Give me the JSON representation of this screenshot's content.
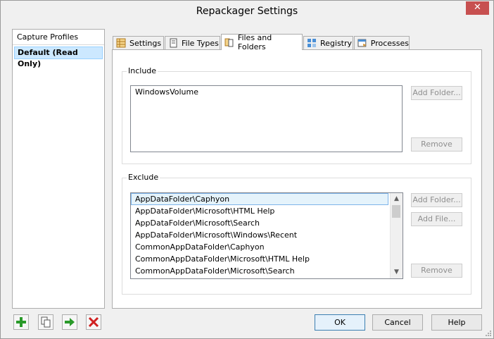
{
  "window": {
    "title": "Repackager Settings",
    "close_glyph": "✕"
  },
  "sidebar": {
    "header": "Capture Profiles",
    "items": [
      {
        "label": "Default (Read Only)"
      }
    ]
  },
  "tabs": [
    {
      "label": "Settings",
      "icon": "settings-grid-icon"
    },
    {
      "label": "File Types",
      "icon": "file-types-icon"
    },
    {
      "label": "Files and Folders",
      "icon": "files-folders-icon",
      "active": true
    },
    {
      "label": "Registry",
      "icon": "registry-icon"
    },
    {
      "label": "Processes",
      "icon": "processes-icon"
    }
  ],
  "include": {
    "label": "Include",
    "items": [
      "WindowsVolume"
    ],
    "add_folder_label": "Add Folder...",
    "remove_label": "Remove"
  },
  "exclude": {
    "label": "Exclude",
    "items": [
      "AppDataFolder\\Caphyon",
      "AppDataFolder\\Microsoft\\HTML Help",
      "AppDataFolder\\Microsoft\\Search",
      "AppDataFolder\\Microsoft\\Windows\\Recent",
      "CommonAppDataFolder\\Caphyon",
      "CommonAppDataFolder\\Microsoft\\HTML Help",
      "CommonAppDataFolder\\Microsoft\\Search"
    ],
    "add_folder_label": "Add Folder...",
    "add_file_label": "Add File...",
    "remove_label": "Remove"
  },
  "footer": {
    "ok_label": "OK",
    "cancel_label": "Cancel",
    "help_label": "Help"
  },
  "colors": {
    "accent": "#3c7fb1",
    "selection": "#cce8ff",
    "close": "#c75050",
    "add_green": "#2a9a2a",
    "delete_red": "#d02020"
  }
}
